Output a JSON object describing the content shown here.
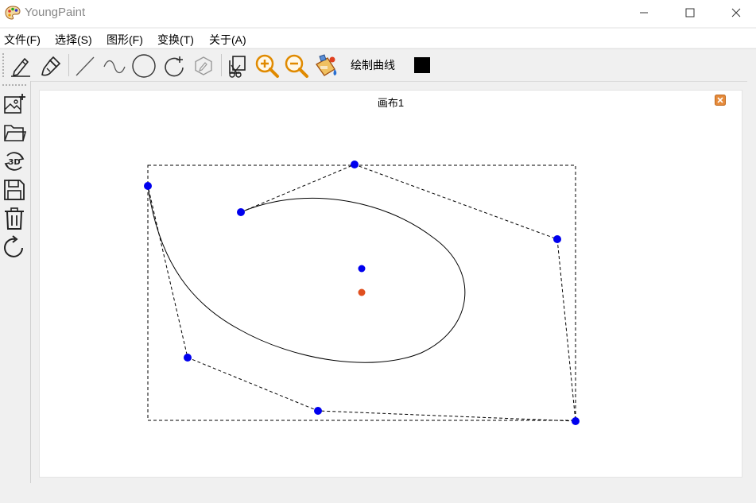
{
  "window": {
    "title": "YoungPaint",
    "app_icon": "palette-icon",
    "controls": [
      "minimize-icon",
      "maximize-icon",
      "close-icon"
    ]
  },
  "menu": [
    {
      "label": "文件(F)"
    },
    {
      "label": "选择(S)"
    },
    {
      "label": "图形(F)"
    },
    {
      "label": "变换(T)"
    },
    {
      "label": "关于(A)"
    }
  ],
  "toolbar": {
    "tools": [
      "pencil-icon",
      "brush-icon",
      "line-icon",
      "curve-icon",
      "ellipse-icon",
      "rotate-shape-icon",
      "eraser-icon",
      "crop-icon",
      "zoom-in-icon",
      "zoom-out-icon",
      "paint-bucket-icon"
    ],
    "status_label": "绘制曲线",
    "current_color": "#000000"
  },
  "sidebar": {
    "tools": [
      "new-image-icon",
      "open-folder-icon",
      "rotate-3d-icon",
      "save-icon",
      "delete-icon",
      "redo-icon"
    ]
  },
  "canvas_tab": {
    "title": "画布1",
    "close_icon": "close-icon"
  },
  "colors": {
    "control_point": "#0000ee",
    "center_point": "#e05020",
    "accent": "#e08030"
  }
}
